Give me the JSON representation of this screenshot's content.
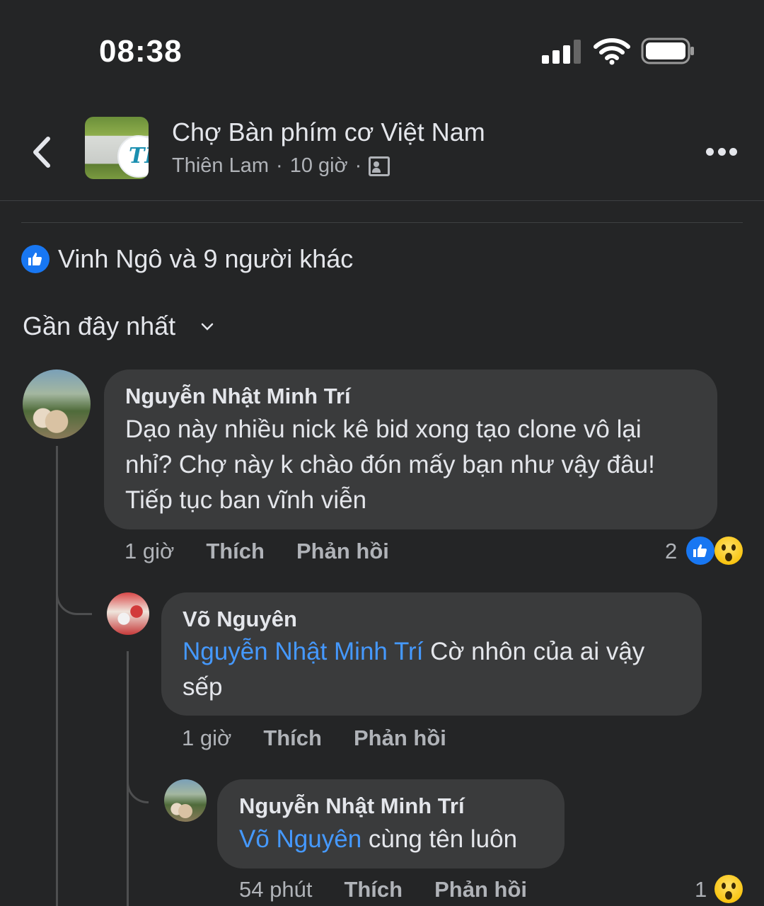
{
  "status_bar": {
    "time": "08:38"
  },
  "header": {
    "group_name": "Chợ Bàn phím cơ Việt Nam",
    "author": "Thiên Lam",
    "separator": "·",
    "time": "10 giờ"
  },
  "reactions": {
    "summary": "Vinh Ngô và 9 người khác"
  },
  "sort": {
    "label": "Gần đây nhất"
  },
  "comments": [
    {
      "author": "Nguyễn Nhật Minh Trí",
      "text_lines": [
        "Dạo này nhiều nick kê bid xong tạo clone vô lại",
        "nhỉ? Chợ này k chào đón mấy bạn như vậy đâu!",
        "Tiếp tục ban vĩnh viễn"
      ],
      "time": "1 giờ",
      "like_label": "Thích",
      "reply_label": "Phản hồi",
      "reaction_count": "2",
      "reactions": [
        "like-icon",
        "wow-icon"
      ]
    },
    {
      "author": "Võ Nguyên",
      "mention": "Nguyễn Nhật Minh Trí",
      "text_rest": " Cờ nhôn của ai vậy",
      "text_line2": "sếp",
      "time": "1 giờ",
      "like_label": "Thích",
      "reply_label": "Phản hồi"
    },
    {
      "author": "Nguyễn Nhật Minh Trí",
      "mention": "Võ Nguyên",
      "text_rest": " cùng tên luôn",
      "time": "54 phút",
      "like_label": "Thích",
      "reply_label": "Phản hồi",
      "reaction_count": "1",
      "reactions": [
        "wow-icon"
      ]
    }
  ],
  "colors": {
    "background": "#242526",
    "bubble": "#3a3b3c",
    "mention": "#4599ff",
    "like": "#1877f2"
  }
}
